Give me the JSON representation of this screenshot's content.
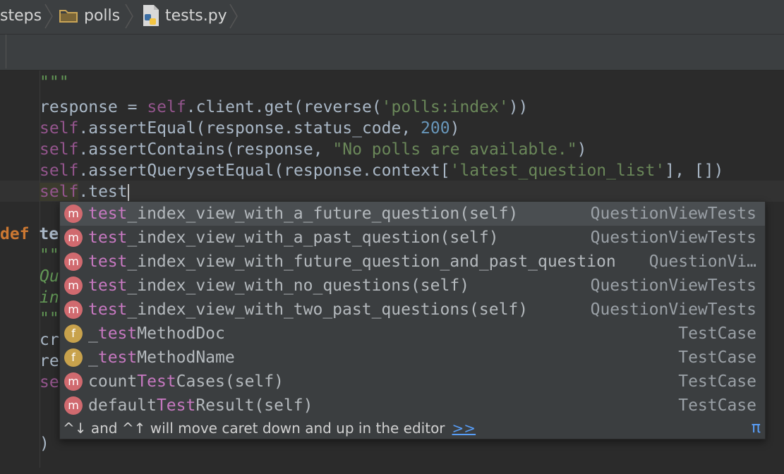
{
  "breadcrumb": {
    "items": [
      "steps",
      "polls",
      "tests.py"
    ],
    "icons": [
      "folder-icon",
      "python-file-icon"
    ]
  },
  "code": {
    "partial_doc_line": "\"\"\"",
    "line_response": {
      "var": "response = ",
      "self": "self",
      "call": ".client.get(reverse(",
      "arg": "'polls:index'",
      "close": "))"
    },
    "line_equal": {
      "self": "self",
      "call": ".assertEqual(response.status_code, ",
      "num": "200",
      "close": ")"
    },
    "line_contains": {
      "self": "self",
      "call": ".assertContains(response, ",
      "str": "\"No polls are available.\"",
      "close": ")"
    },
    "line_qs": {
      "self": "self",
      "call": ".assertQuerysetEqual(response.context[",
      "str": "'latest_question_list'",
      "close": "], [])"
    },
    "line_current": {
      "self": "self",
      "typed": ".test"
    },
    "def_keyword": "def",
    "def_name_partial": "te",
    "doc_open": "\"\"",
    "doc_line1": "Qu",
    "doc_line2": "in",
    "doc_close": "\"\"",
    "line_cr": "cr",
    "line_re": "re",
    "line_se": "se",
    "close_paren": ")"
  },
  "completion": {
    "items": [
      {
        "kind": "m",
        "match": "test",
        "rest": "_index_view_with_a_future_question(self)",
        "owner": "QuestionViewTests",
        "selected": true
      },
      {
        "kind": "m",
        "match": "test",
        "rest": "_index_view_with_a_past_question(self)",
        "owner": "QuestionViewTests"
      },
      {
        "kind": "m",
        "match": "test",
        "rest": "_index_view_with_future_question_and_past_question",
        "owner": "QuestionVi…"
      },
      {
        "kind": "m",
        "match": "test",
        "rest": "_index_view_with_no_questions(self)",
        "owner": "QuestionViewTests"
      },
      {
        "kind": "m",
        "match": "test",
        "rest": "_index_view_with_two_past_questions(self)",
        "owner": "QuestionViewTests"
      },
      {
        "kind": "f",
        "pre": "_",
        "match": "test",
        "rest": "MethodDoc",
        "owner": "TestCase"
      },
      {
        "kind": "f",
        "pre": "_",
        "match": "test",
        "rest": "MethodName",
        "owner": "TestCase"
      },
      {
        "kind": "m",
        "pre": "count",
        "match": "Test",
        "rest": "Cases(self)",
        "owner": "TestCase"
      },
      {
        "kind": "m",
        "pre": "default",
        "match": "Test",
        "rest": "Result(self)",
        "owner": "TestCase"
      }
    ],
    "footer_hint": "^↓ and ^↑ will move caret down and up in the editor",
    "footer_link": ">>",
    "footer_symbol": "π"
  },
  "colors": {
    "editor_bg": "#2b2b2b",
    "self_keyword": "#94558d",
    "string": "#6a8759",
    "number": "#6897bb",
    "keyword": "#cc7832",
    "match_highlight": "#c678c0",
    "method_badge": "#d06a6f",
    "field_badge": "#c8a24c",
    "link": "#589df6"
  }
}
